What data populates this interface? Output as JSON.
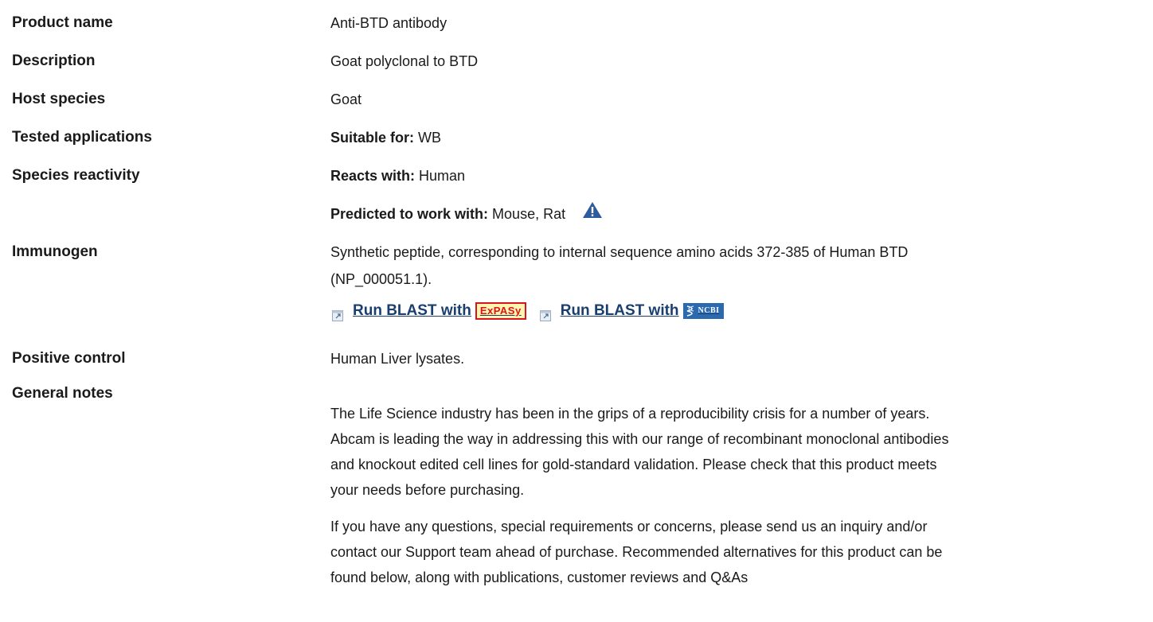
{
  "product_name": {
    "label": "Product name",
    "value": "Anti-BTD antibody"
  },
  "description": {
    "label": "Description",
    "value": "Goat polyclonal to BTD"
  },
  "host_species": {
    "label": "Host species",
    "value": "Goat"
  },
  "tested_applications": {
    "label": "Tested applications",
    "prefix": "Suitable for:",
    "value": "WB"
  },
  "species_reactivity": {
    "label": "Species reactivity",
    "reacts_prefix": "Reacts with:",
    "reacts_value": "Human",
    "predicted_prefix": "Predicted to work with:",
    "predicted_value": "Mouse, Rat",
    "warning_icon": "warning-triangle-icon"
  },
  "immunogen": {
    "label": "Immunogen",
    "line1": "Synthetic peptide, corresponding to internal sequence amino acids 372-385 of Human BTD",
    "line2": "(NP_000051.1).",
    "blast_expasy_label": "Run BLAST with",
    "expasy_logo_text": "ExPASy",
    "blast_ncbi_label": "Run BLAST with",
    "ncbi_logo_text": "NCBI"
  },
  "positive_control": {
    "label": "Positive control",
    "value": "Human Liver lysates."
  },
  "general_notes": {
    "label": "General notes",
    "para1_lines": [
      "The Life Science industry has been in the grips of a reproducibility crisis for a number of years.",
      "Abcam is leading the way in addressing this with our range of recombinant monoclonal antibodies",
      "and knockout edited cell lines for gold-standard validation. Please check that this product meets",
      "your needs before purchasing."
    ],
    "para2_lines": [
      "If you have any questions, special requirements or concerns, please send us an inquiry and/or",
      "contact our Support team ahead of purchase. Recommended alternatives for this product can be",
      "found below, along with publications, customer reviews and Q&As"
    ]
  },
  "colors": {
    "text": "#1a1a1a",
    "link": "#1a3f6e",
    "warning_icon": "#2c5b9e",
    "expasy_red": "#d8141e",
    "ncbi_blue": "#2c6ab0"
  }
}
